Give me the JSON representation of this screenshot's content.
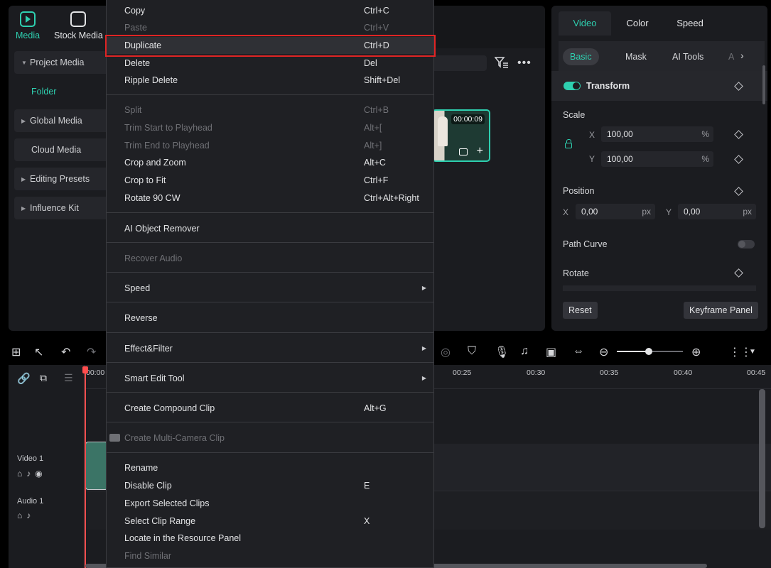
{
  "media_panel": {
    "nav": [
      {
        "label": "Media",
        "icon": "media-icon"
      },
      {
        "label": "Stock Media",
        "icon": "stock-media-icon"
      }
    ],
    "items": [
      {
        "label": "Project Media",
        "caret": true
      },
      {
        "label": "Folder",
        "sub": true
      },
      {
        "label": "Global Media",
        "caret": true
      },
      {
        "label": "Cloud Media",
        "caret": false
      },
      {
        "label": "Editing Presets",
        "caret": true
      },
      {
        "label": "Influence Kit",
        "caret": true
      }
    ]
  },
  "media_clip": {
    "duration": "00:00:09"
  },
  "properties": {
    "tabs": [
      "Video",
      "Color",
      "Speed"
    ],
    "subtabs": [
      "Basic",
      "Mask",
      "AI Tools",
      "A"
    ],
    "transform_label": "Transform",
    "scale_label": "Scale",
    "scale_x": "100,00",
    "scale_y": "100,00",
    "scale_unit": "%",
    "position_label": "Position",
    "pos_x": "0,00",
    "pos_y": "0,00",
    "pos_unit": "px",
    "axis_x": "X",
    "axis_y": "Y",
    "path_curve_label": "Path Curve",
    "rotate_label": "Rotate",
    "reset_label": "Reset",
    "keyframe_label": "Keyframe Panel"
  },
  "timeline": {
    "ruler": [
      "00:00",
      "00:25",
      "00:30",
      "00:35",
      "00:40",
      "00:45"
    ],
    "video_track": "Video 1",
    "audio_track": "Audio 1"
  },
  "context_menu": {
    "items": [
      {
        "label": "Copy",
        "shortcut": "Ctrl+C",
        "disabled": false
      },
      {
        "label": "Paste",
        "shortcut": "Ctrl+V",
        "disabled": true
      },
      {
        "label": "Duplicate",
        "shortcut": "Ctrl+D",
        "disabled": false,
        "highlight": true
      },
      {
        "label": "Delete",
        "shortcut": "Del",
        "disabled": false
      },
      {
        "label": "Ripple Delete",
        "shortcut": "Shift+Del",
        "disabled": false
      },
      {
        "label": "Split",
        "shortcut": "Ctrl+B",
        "disabled": true
      },
      {
        "label": "Trim Start to Playhead",
        "shortcut": "Alt+[",
        "disabled": true
      },
      {
        "label": "Trim End to Playhead",
        "shortcut": "Alt+]",
        "disabled": true
      },
      {
        "label": "Crop and Zoom",
        "shortcut": "Alt+C",
        "disabled": false
      },
      {
        "label": "Crop to Fit",
        "shortcut": "Ctrl+F",
        "disabled": false
      },
      {
        "label": "Rotate 90 CW",
        "shortcut": "Ctrl+Alt+Right",
        "disabled": false
      },
      {
        "label": "AI Object Remover",
        "shortcut": "",
        "disabled": false
      },
      {
        "label": "Recover Audio",
        "shortcut": "",
        "disabled": true
      },
      {
        "label": "Speed",
        "shortcut": "",
        "disabled": false,
        "submenu": true
      },
      {
        "label": "Reverse",
        "shortcut": "",
        "disabled": false
      },
      {
        "label": "Effect&Filter",
        "shortcut": "",
        "disabled": false,
        "submenu": true
      },
      {
        "label": "Smart Edit Tool",
        "shortcut": "",
        "disabled": false,
        "submenu": true
      },
      {
        "label": "Create Compound Clip",
        "shortcut": "Alt+G",
        "disabled": false
      },
      {
        "label": "Create Multi-Camera Clip",
        "shortcut": "",
        "disabled": true
      },
      {
        "label": "Rename",
        "shortcut": "",
        "disabled": false
      },
      {
        "label": "Disable Clip",
        "shortcut": "E",
        "disabled": false
      },
      {
        "label": "Export Selected Clips",
        "shortcut": "",
        "disabled": false
      },
      {
        "label": "Select Clip Range",
        "shortcut": "X",
        "disabled": false
      },
      {
        "label": "Locate in the Resource Panel",
        "shortcut": "",
        "disabled": false
      },
      {
        "label": "Find Similar",
        "shortcut": "",
        "disabled": true
      }
    ]
  },
  "colors": {
    "accent": "#2ed0b0",
    "highlight_outline": "#e02424",
    "playhead": "#ff4d4d"
  }
}
